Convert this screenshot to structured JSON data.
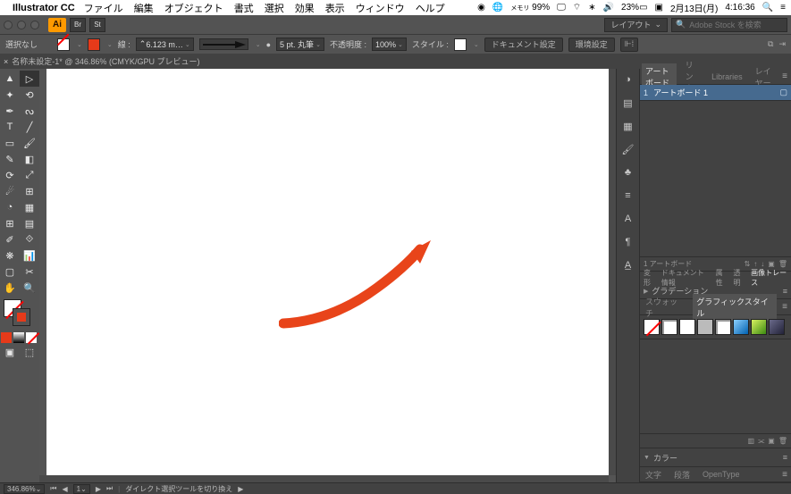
{
  "menubar": {
    "app_name": "Illustrator CC",
    "items": [
      "ファイル",
      "編集",
      "オブジェクト",
      "書式",
      "選択",
      "効果",
      "表示",
      "ウィンドウ",
      "ヘルプ"
    ],
    "right": {
      "mem": "99%",
      "battery": "23%",
      "date": "2月13日(月)",
      "time": "4:16:36"
    }
  },
  "appbar": {
    "ai": "Ai",
    "badges": [
      "Br",
      "St"
    ],
    "layout_label": "レイアウト",
    "search_placeholder": "Adobe Stock を検索"
  },
  "controlbar": {
    "selection": "選択なし",
    "stroke_label": "線 :",
    "stroke_width": "6.123 m…",
    "brush_tip": "5 pt. 丸筆",
    "opacity_label": "不透明度 :",
    "opacity_value": "100%",
    "style_label": "スタイル :",
    "doc_setup": "ドキュメント設定",
    "env_setup": "環境設定"
  },
  "tab": {
    "title": "名称未設定-1* @ 346.86% (CMYK/GPU プレビュー)"
  },
  "artboard_panel": {
    "tabs": [
      "アートボード",
      "リンク",
      "Libraries",
      "レイヤー"
    ],
    "active_tab": 0,
    "row": {
      "num": "1",
      "name": "アートボード 1"
    },
    "footer": "1 アートボード"
  },
  "properties_row": [
    "変形",
    "ドキュメント情報",
    "属性",
    "透明",
    "画像トレース"
  ],
  "gradation_label": "グラデーション",
  "styles_panel": {
    "tabs": [
      "スウォッチ",
      "グラフィックスタイル"
    ],
    "active_tab": 1
  },
  "color_label": "カラー",
  "bottom_tabs": [
    "文字",
    "段落",
    "OpenType"
  ],
  "statusbar": {
    "zoom": "346.86%",
    "artboard_nav": "1",
    "tool_hint": "ダイレクト選択ツールを切り換え"
  }
}
